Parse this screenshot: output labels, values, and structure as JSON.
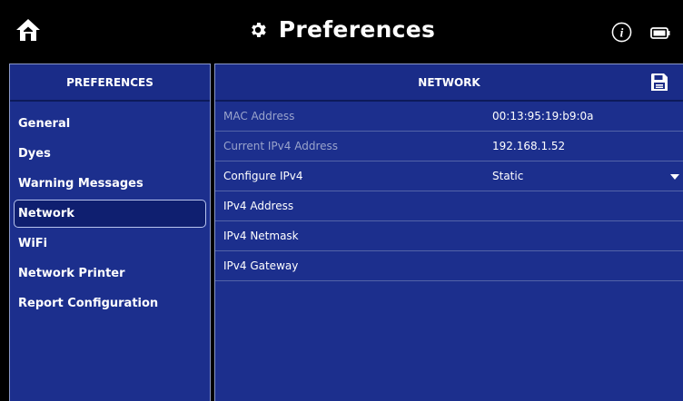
{
  "header": {
    "title": "Preferences",
    "icons": {
      "home": "home-icon",
      "gear": "gear-icon",
      "info": "info-icon",
      "battery": "battery-icon"
    }
  },
  "sidebar": {
    "title": "PREFERENCES",
    "items": [
      {
        "label": "General"
      },
      {
        "label": "Dyes"
      },
      {
        "label": "Warning Messages"
      },
      {
        "label": "Network",
        "selected": true
      },
      {
        "label": "WiFi"
      },
      {
        "label": "Network Printer"
      },
      {
        "label": "Report Configuration"
      }
    ]
  },
  "main": {
    "title": "NETWORK",
    "save_icon": "save-icon",
    "rows": [
      {
        "label": "MAC Address",
        "value": "00:13:95:19:b9:0a",
        "disabled": true
      },
      {
        "label": "Current IPv4 Address",
        "value": "192.168.1.52",
        "disabled": true
      },
      {
        "label": "Configure IPv4",
        "value": "Static",
        "dropdown": true
      },
      {
        "label": "IPv4 Address",
        "value": ""
      },
      {
        "label": "IPv4 Netmask",
        "value": ""
      },
      {
        "label": "IPv4 Gateway",
        "value": ""
      }
    ]
  },
  "colors": {
    "panel_bg": "#1c2f8d",
    "border": "#8a98c8",
    "disabled_text": "#9aa4cc"
  }
}
